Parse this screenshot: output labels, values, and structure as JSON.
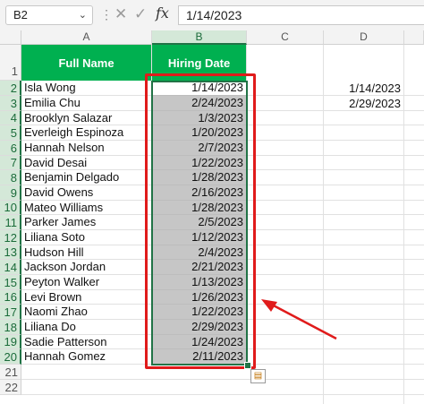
{
  "formula_bar": {
    "name_box": "B2",
    "formula": "1/14/2023",
    "fx_label": "fx"
  },
  "columns": [
    "A",
    "B",
    "C",
    "D"
  ],
  "headers": {
    "full_name": "Full Name",
    "hiring_date": "Hiring Date"
  },
  "rows": [
    {
      "num": "1"
    },
    {
      "num": "2",
      "name": "Isla Wong",
      "date": "1/14/2023",
      "d": "1/14/2023"
    },
    {
      "num": "3",
      "name": "Emilia Chu",
      "date": "2/24/2023",
      "d": "2/29/2023"
    },
    {
      "num": "4",
      "name": "Brooklyn Salazar",
      "date": "1/3/2023"
    },
    {
      "num": "5",
      "name": "Everleigh Espinoza",
      "date": "1/20/2023"
    },
    {
      "num": "6",
      "name": "Hannah Nelson",
      "date": "2/7/2023"
    },
    {
      "num": "7",
      "name": "David Desai",
      "date": "1/22/2023"
    },
    {
      "num": "8",
      "name": "Benjamin Delgado",
      "date": "1/28/2023"
    },
    {
      "num": "9",
      "name": "David Owens",
      "date": "2/16/2023"
    },
    {
      "num": "10",
      "name": "Mateo Williams",
      "date": "1/28/2023"
    },
    {
      "num": "11",
      "name": "Parker James",
      "date": "2/5/2023"
    },
    {
      "num": "12",
      "name": "Liliana Soto",
      "date": "1/12/2023"
    },
    {
      "num": "13",
      "name": "Hudson Hill",
      "date": "2/4/2023"
    },
    {
      "num": "14",
      "name": "Jackson Jordan",
      "date": "2/21/2023"
    },
    {
      "num": "15",
      "name": "Peyton Walker",
      "date": "1/13/2023"
    },
    {
      "num": "16",
      "name": "Levi Brown",
      "date": "1/26/2023"
    },
    {
      "num": "17",
      "name": "Naomi Zhao",
      "date": "1/22/2023"
    },
    {
      "num": "18",
      "name": "Liliana Do",
      "date": "2/29/2023"
    },
    {
      "num": "19",
      "name": "Sadie Patterson",
      "date": "1/24/2023"
    },
    {
      "num": "20",
      "name": "Hannah Gomez",
      "date": "2/11/2023"
    },
    {
      "num": "21"
    },
    {
      "num": "22"
    }
  ],
  "colors": {
    "header_fill": "#00b050",
    "selection_fill": "#c6c6c6",
    "annotation": "#e01b1b",
    "excel_green": "#217346"
  }
}
